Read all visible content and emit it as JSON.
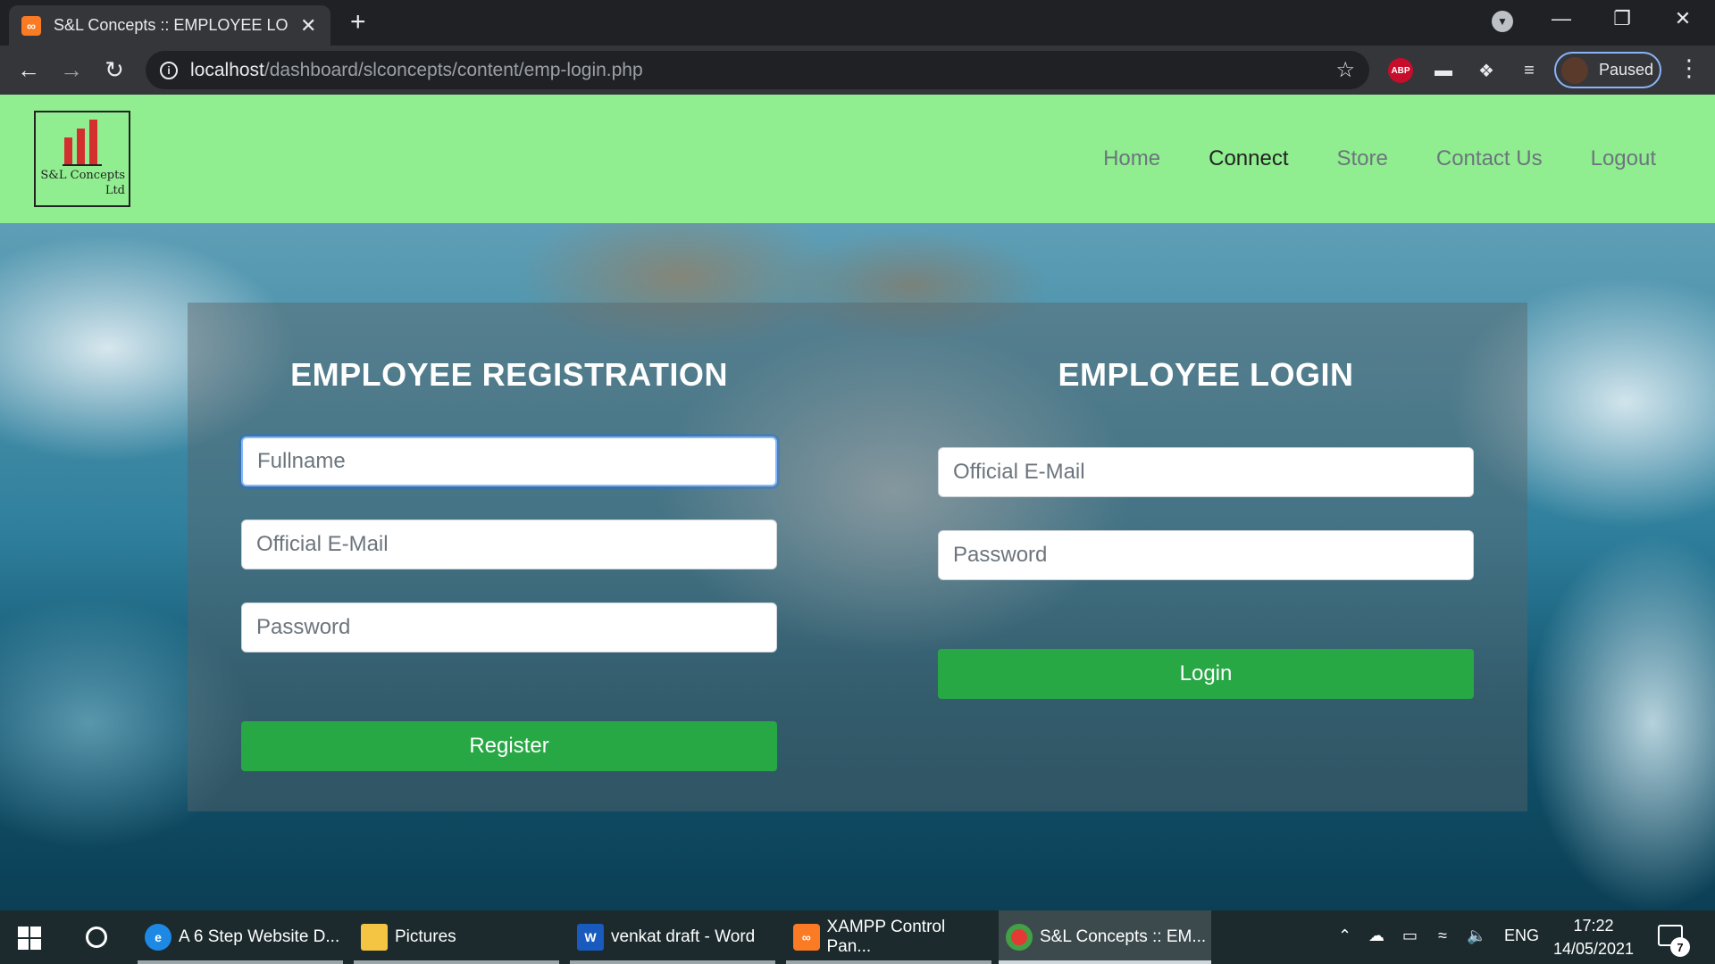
{
  "browser": {
    "tab_title": "S&L Concepts :: EMPLOYEE LOGIN",
    "url_host": "localhost",
    "url_path": "/dashboard/slconcepts/content/emp-login.php",
    "profile_label": "Paused",
    "abp_label": "ABP"
  },
  "site": {
    "logo_text_line1": "S&L Concepts",
    "logo_text_line2": "Ltd",
    "nav": [
      "Home",
      "Connect",
      "Store",
      "Contact Us",
      "Logout"
    ]
  },
  "registration": {
    "title": "EMPLOYEE REGISTRATION",
    "fullname_placeholder": "Fullname",
    "email_placeholder": "Official E-Mail",
    "password_placeholder": "Password",
    "button_label": "Register"
  },
  "login": {
    "title": "EMPLOYEE LOGIN",
    "email_placeholder": "Official E-Mail",
    "password_placeholder": "Password",
    "button_label": "Login"
  },
  "taskbar": {
    "apps": [
      {
        "label": "A 6 Step Website D...",
        "icon": "edge-icon"
      },
      {
        "label": "Pictures",
        "icon": "folder-icon"
      },
      {
        "label": "venkat draft - Word",
        "icon": "word-icon"
      },
      {
        "label": "XAMPP Control Pan...",
        "icon": "xampp-icon"
      },
      {
        "label": "S&L Concepts :: EM...",
        "icon": "chrome-icon"
      }
    ],
    "language": "ENG",
    "time": "17:22",
    "date": "14/05/2021",
    "notification_count": "7"
  },
  "colors": {
    "header_bg": "#90ee90",
    "button_green": "#28a745",
    "focus_border": "#86b7fe"
  }
}
